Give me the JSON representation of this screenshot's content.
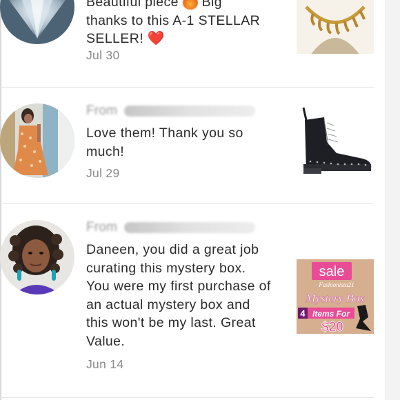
{
  "reviews": [
    {
      "from_prefix": "",
      "line_partial": "Beautiful piece",
      "line_after_emoji": "Big",
      "message_rest": "thanks to this A-1 STELLAR SELLER!",
      "emoji": "fire-emoji",
      "heart": "❤️",
      "date": "Jul 30",
      "avatar": "diamond-avatar",
      "thumb": "gold-necklace-thumbnail"
    },
    {
      "from_prefix": "From",
      "message": "Love them! Thank you so much!",
      "message_line1": "Love them! Thank you so",
      "message_line2": "much!",
      "date": "Jul 29",
      "avatar": "woman-orange-dress-avatar",
      "thumb": "black-lace-up-boot-thumbnail"
    },
    {
      "from_prefix": "From",
      "message_lines": [
        "Daneen, you did a great job",
        "curating this mystery box.",
        "You were my first purchase of",
        "an actual mystery box and",
        "this won't be my last. Great",
        "Value."
      ],
      "date": "Jun 14",
      "avatar": "woman-curly-hair-avatar",
      "thumb": {
        "name": "mystery-box-sale-thumbnail",
        "sale": "sale",
        "brand": "Fashionista21",
        "title": "Mystery Box",
        "count": "4",
        "offer": "Items For",
        "price": "$20"
      }
    }
  ],
  "colors": {
    "divider": "#e6e6e6",
    "date": "#8a8a8a",
    "text": "#2b2b2b",
    "heart": "#d8232a",
    "sale_pink": "#e94c97"
  }
}
